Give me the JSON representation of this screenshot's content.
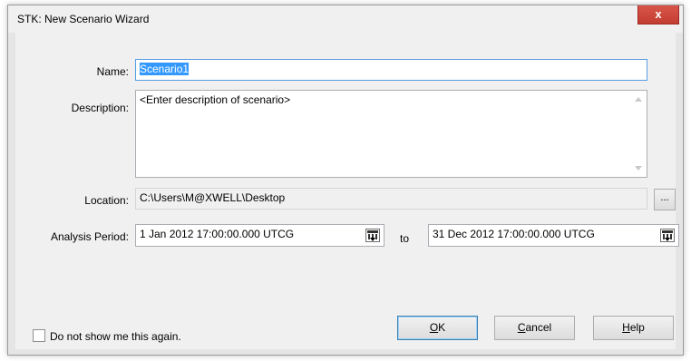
{
  "window": {
    "title": "STK: New Scenario Wizard",
    "close_glyph": "x"
  },
  "form": {
    "name_label": "Name:",
    "name_value": "Scenario1",
    "description_label": "Description:",
    "description_value": "<Enter description of scenario>",
    "location_label": "Location:",
    "location_value": "C:\\Users\\M@XWELL\\Desktop",
    "browse_label": "...",
    "analysis_period_label": "Analysis Period:",
    "start_time": "1 Jan 2012 17:00:00.000 UTCG",
    "to_label": "to",
    "stop_time": "31 Dec 2012 17:00:00.000 UTCG"
  },
  "footer": {
    "checkbox_label": "Do not show me this again.",
    "checkbox_checked": false,
    "ok_mnemonic": "O",
    "ok_rest": "K",
    "cancel_mnemonic": "C",
    "cancel_rest": "ancel",
    "help_mnemonic": "H",
    "help_rest": "elp"
  },
  "colors": {
    "selection": "#3399ff",
    "close_button": "#c33c31",
    "dialog_background": "#f0f0f0"
  },
  "icons": [
    "close-icon",
    "calendar-icon",
    "scroll-up-icon",
    "scroll-down-icon",
    "checkbox-icon"
  ]
}
